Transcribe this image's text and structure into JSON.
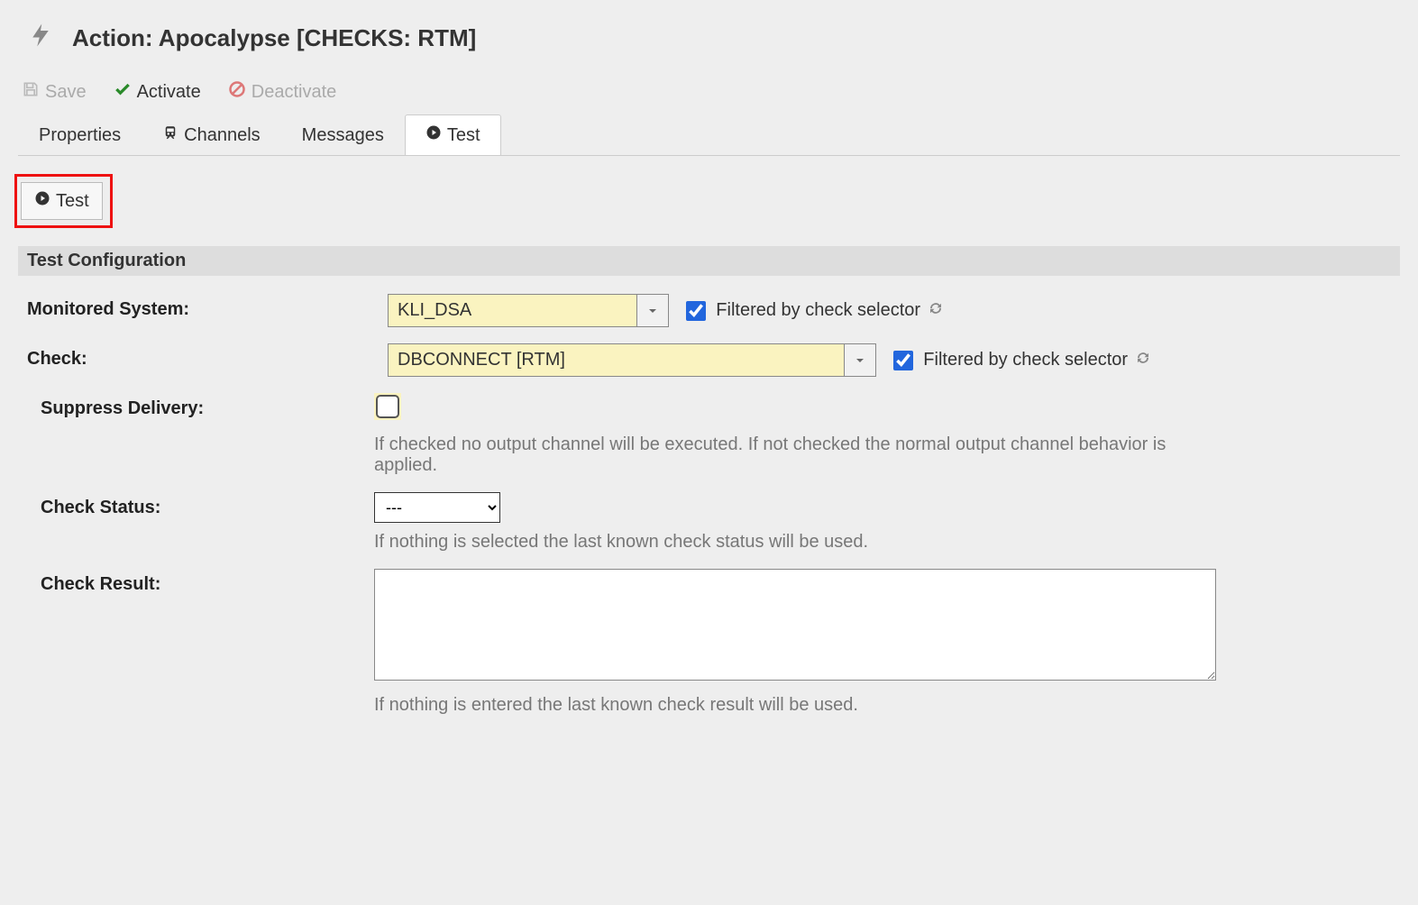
{
  "header": {
    "title": "Action: Apocalypse [CHECKS: RTM]"
  },
  "toolbar": {
    "save_label": "Save",
    "activate_label": "Activate",
    "deactivate_label": "Deactivate"
  },
  "tabs": {
    "properties": "Properties",
    "channels": "Channels",
    "messages": "Messages",
    "test": "Test"
  },
  "panel": {
    "test_button": "Test",
    "section_title": "Test Configuration",
    "monitored_system": {
      "label": "Monitored System:",
      "value": "KLI_DSA",
      "filter_checked": true,
      "filter_label": "Filtered by check selector"
    },
    "check": {
      "label": "Check:",
      "value": "DBCONNECT [RTM]",
      "filter_checked": true,
      "filter_label": "Filtered by check selector"
    },
    "suppress": {
      "label": "Suppress Delivery:",
      "checked": false,
      "help": "If checked no output channel will be executed. If not checked the normal output channel behavior is applied."
    },
    "check_status": {
      "label": "Check Status:",
      "value": "---",
      "help": "If nothing is selected the last known check status will be used."
    },
    "check_result": {
      "label": "Check Result:",
      "value": "",
      "help": "If nothing is entered the last known check result will be used."
    }
  }
}
